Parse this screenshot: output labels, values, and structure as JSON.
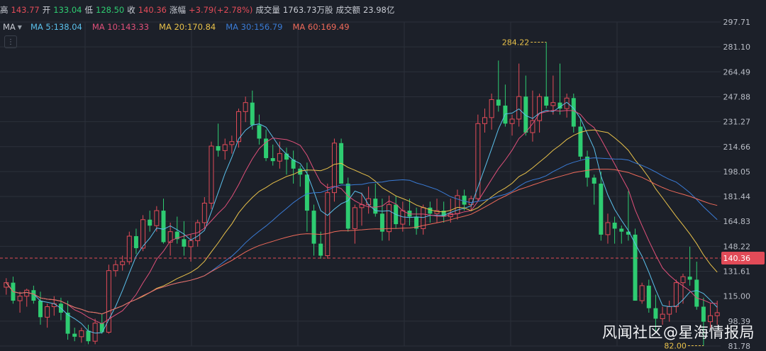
{
  "quote": {
    "high_label": "高",
    "high": "143.77",
    "open_label": "开",
    "open": "133.04",
    "low_label": "低",
    "low": "128.50",
    "close_label": "收",
    "close": "140.36",
    "change_label": "涨幅",
    "change": "+3.79(+2.78%)",
    "volume_label": "成交量",
    "volume": "1763.73万股",
    "amount_label": "成交额",
    "amount": "23.98亿"
  },
  "ma": {
    "selector_label": "MA",
    "items": [
      {
        "label": "MA 5:138.04",
        "color": "#5bc0eb"
      },
      {
        "label": "MA 10:143.33",
        "color": "#e0507a"
      },
      {
        "label": "MA 20:170.84",
        "color": "#e8c14a"
      },
      {
        "label": "MA 30:156.79",
        "color": "#3a7bd5"
      },
      {
        "label": "MA 60:169.49",
        "color": "#ef6a5a"
      }
    ]
  },
  "watermark": "风闻社区@星海情报局",
  "chart_data": {
    "type": "candlestick",
    "y_ticks": [
      "297.71",
      "281.10",
      "264.49",
      "247.88",
      "231.27",
      "214.66",
      "198.05",
      "181.44",
      "164.83",
      "148.22",
      "131.61",
      "115.00",
      "98.39",
      "81.78"
    ],
    "ylim": [
      81.78,
      297.71
    ],
    "current_price": "140.36",
    "annotations": {
      "max": "284.22",
      "min": "82.00"
    },
    "colors": {
      "up": "#e24b58",
      "down": "#2ecc71",
      "current_line": "#e24b58",
      "grid": "#2b303a"
    },
    "candles": [
      [
        121,
        127,
        116,
        124
      ],
      [
        124,
        128,
        110,
        112
      ],
      [
        112,
        118,
        104,
        115
      ],
      [
        115,
        120,
        108,
        119
      ],
      [
        119,
        122,
        110,
        112
      ],
      [
        112,
        118,
        96,
        101
      ],
      [
        101,
        110,
        94,
        108
      ],
      [
        108,
        115,
        102,
        110
      ],
      [
        110,
        114,
        99,
        104
      ],
      [
        104,
        112,
        86,
        90
      ],
      [
        90,
        94,
        85,
        88
      ],
      [
        88,
        94,
        84,
        92
      ],
      [
        92,
        96,
        83,
        85
      ],
      [
        85,
        100,
        83,
        97
      ],
      [
        97,
        103,
        90,
        91
      ],
      [
        91,
        136,
        90,
        132
      ],
      [
        132,
        139,
        128,
        136
      ],
      [
        136,
        142,
        132,
        138
      ],
      [
        138,
        158,
        136,
        155
      ],
      [
        155,
        160,
        143,
        147
      ],
      [
        147,
        169,
        145,
        166
      ],
      [
        166,
        172,
        158,
        162
      ],
      [
        162,
        175,
        158,
        172
      ],
      [
        172,
        180,
        150,
        151
      ],
      [
        151,
        164,
        142,
        158
      ],
      [
        158,
        168,
        150,
        153
      ],
      [
        153,
        165,
        142,
        148
      ],
      [
        148,
        156,
        138,
        152
      ],
      [
        152,
        166,
        148,
        164
      ],
      [
        164,
        181,
        160,
        177
      ],
      [
        177,
        218,
        173,
        215
      ],
      [
        215,
        230,
        208,
        212
      ],
      [
        212,
        220,
        206,
        216
      ],
      [
        216,
        222,
        210,
        218
      ],
      [
        218,
        240,
        214,
        238
      ],
      [
        238,
        248,
        231,
        244
      ],
      [
        244,
        252,
        226,
        229
      ],
      [
        229,
        236,
        216,
        220
      ],
      [
        220,
        226,
        205,
        207
      ],
      [
        207,
        216,
        202,
        205
      ],
      [
        205,
        218,
        200,
        210
      ],
      [
        210,
        214,
        196,
        206
      ],
      [
        206,
        212,
        190,
        200
      ],
      [
        200,
        202,
        188,
        196
      ],
      [
        196,
        204,
        158,
        172
      ],
      [
        172,
        176,
        142,
        150
      ],
      [
        150,
        158,
        140,
        142
      ],
      [
        142,
        190,
        140,
        184
      ],
      [
        184,
        220,
        178,
        217
      ],
      [
        217,
        220,
        190,
        190
      ],
      [
        190,
        194,
        158,
        160
      ],
      [
        160,
        176,
        150,
        174
      ],
      [
        174,
        184,
        162,
        176
      ],
      [
        176,
        188,
        170,
        180
      ],
      [
        180,
        190,
        168,
        170
      ],
      [
        170,
        180,
        152,
        158
      ],
      [
        158,
        182,
        152,
        176
      ],
      [
        176,
        182,
        160,
        163
      ],
      [
        163,
        178,
        158,
        172
      ],
      [
        172,
        180,
        162,
        168
      ],
      [
        168,
        174,
        156,
        160
      ],
      [
        160,
        176,
        156,
        174
      ],
      [
        174,
        178,
        164,
        170
      ],
      [
        170,
        180,
        164,
        172
      ],
      [
        172,
        178,
        164,
        168
      ],
      [
        168,
        180,
        164,
        170
      ],
      [
        170,
        186,
        166,
        182
      ],
      [
        182,
        186,
        172,
        176
      ],
      [
        176,
        182,
        172,
        180
      ],
      [
        180,
        236,
        178,
        230
      ],
      [
        230,
        240,
        224,
        234
      ],
      [
        234,
        250,
        226,
        246
      ],
      [
        246,
        272,
        238,
        242
      ],
      [
        242,
        256,
        228,
        230
      ],
      [
        230,
        236,
        222,
        233
      ],
      [
        233,
        270,
        228,
        248
      ],
      [
        248,
        262,
        222,
        224
      ],
      [
        224,
        252,
        218,
        232
      ],
      [
        232,
        250,
        224,
        248
      ],
      [
        248,
        284.22,
        240,
        242
      ],
      [
        242,
        262,
        236,
        244
      ],
      [
        244,
        270,
        236,
        240
      ],
      [
        240,
        250,
        234,
        247
      ],
      [
        247,
        250,
        224,
        228
      ],
      [
        228,
        234,
        206,
        208
      ],
      [
        208,
        212,
        188,
        194
      ],
      [
        194,
        196,
        176,
        190
      ],
      [
        190,
        198,
        152,
        156
      ],
      [
        156,
        170,
        150,
        164
      ],
      [
        164,
        168,
        150,
        160
      ],
      [
        160,
        162,
        150,
        158
      ],
      [
        158,
        185,
        152,
        156
      ],
      [
        156,
        160,
        112,
        112
      ],
      [
        112,
        124,
        110,
        122
      ],
      [
        122,
        126,
        104,
        107
      ],
      [
        107,
        116,
        92,
        100
      ],
      [
        100,
        108,
        96,
        103
      ],
      [
        103,
        112,
        98,
        108
      ],
      [
        108,
        126,
        104,
        124
      ],
      [
        124,
        130,
        110,
        128
      ],
      [
        128,
        148,
        122,
        126
      ],
      [
        126,
        138,
        106,
        108
      ],
      [
        108,
        114,
        82,
        98
      ],
      [
        98,
        110,
        94,
        102
      ],
      [
        102,
        112,
        96,
        104
      ]
    ]
  }
}
